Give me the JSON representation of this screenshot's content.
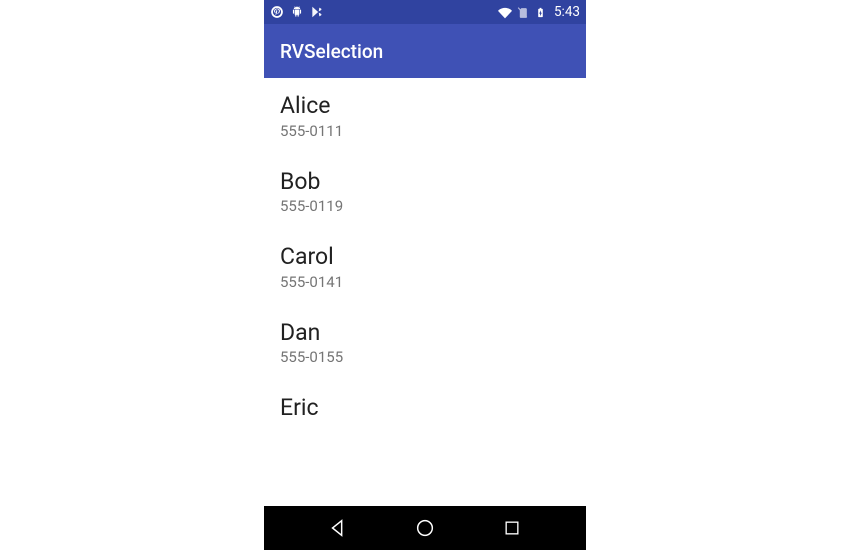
{
  "status_bar": {
    "time": "5:43"
  },
  "app_bar": {
    "title": "RVSelection"
  },
  "contacts": [
    {
      "name": "Alice",
      "phone": "555-0111"
    },
    {
      "name": "Bob",
      "phone": "555-0119"
    },
    {
      "name": "Carol",
      "phone": "555-0141"
    },
    {
      "name": "Dan",
      "phone": "555-0155"
    },
    {
      "name": "Eric",
      "phone": ""
    }
  ]
}
